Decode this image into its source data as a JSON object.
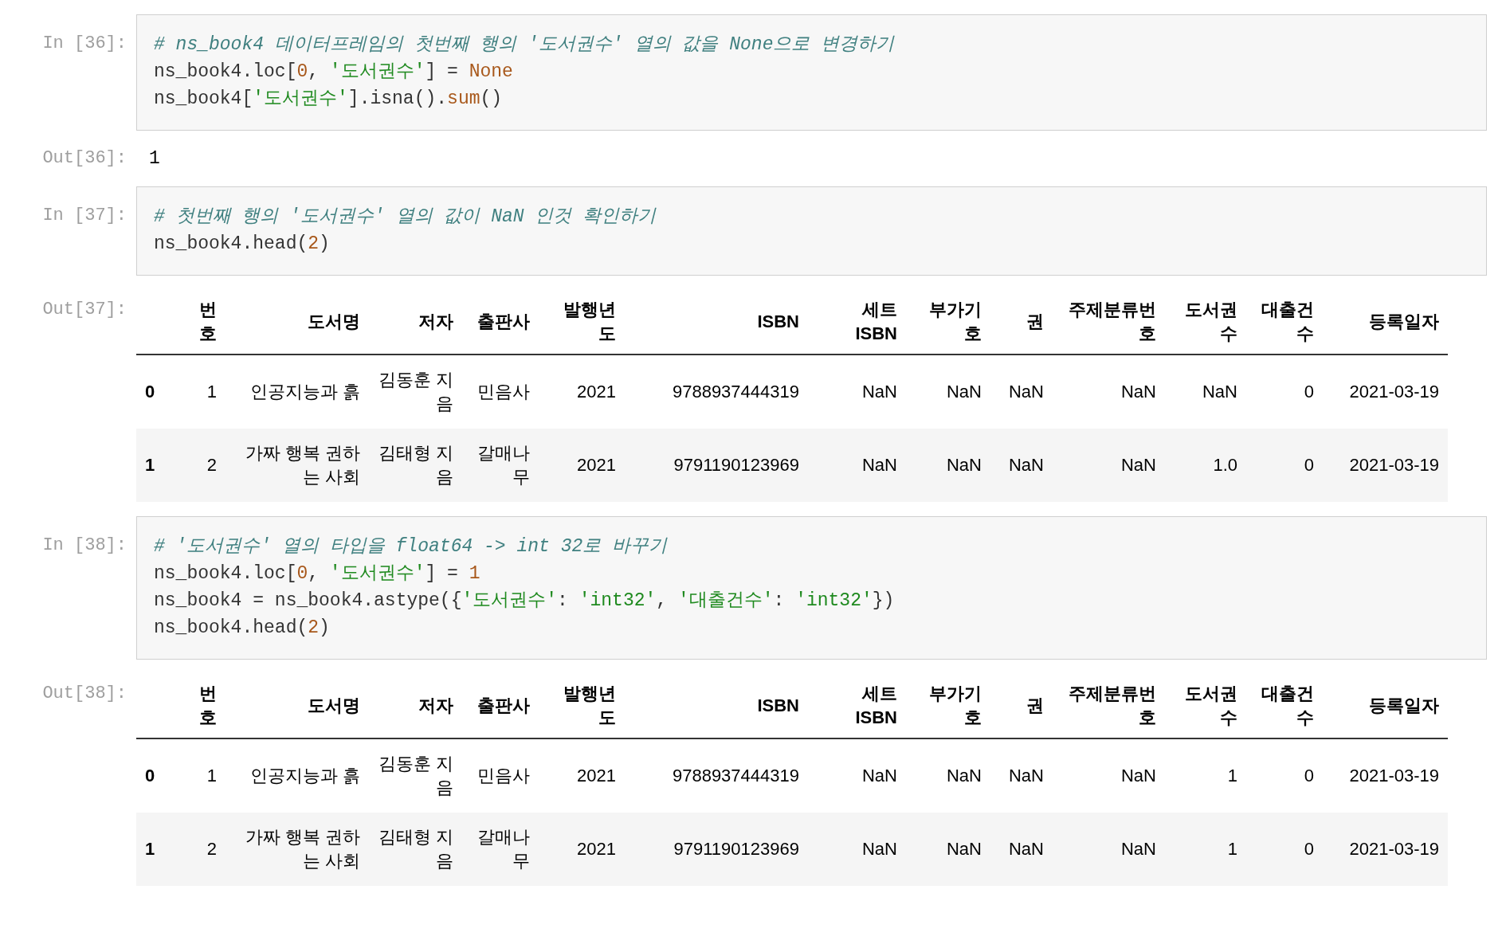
{
  "cells": [
    {
      "kind": "code",
      "prompt": "In [36]:",
      "lines": [
        [
          {
            "kind": "comment",
            "t": "# ns_book4 데이터프레임의 첫번째 행의 '도서권수' 열의 값을 None으로 변경하기"
          }
        ],
        [
          {
            "kind": "name",
            "t": "ns_book4.loc["
          },
          {
            "kind": "number",
            "t": "0"
          },
          {
            "kind": "name",
            "t": ", "
          },
          {
            "kind": "string",
            "t": "'도서권수'"
          },
          {
            "kind": "name",
            "t": "] = "
          },
          {
            "kind": "keyword",
            "t": "None"
          }
        ],
        [
          {
            "kind": "name",
            "t": "ns_book4["
          },
          {
            "kind": "string",
            "t": "'도서권수'"
          },
          {
            "kind": "name",
            "t": "].isna()."
          },
          {
            "kind": "builtin",
            "t": "sum"
          },
          {
            "kind": "name",
            "t": "()"
          }
        ]
      ]
    },
    {
      "kind": "text_output",
      "prompt": "Out[36]:",
      "text": "1"
    },
    {
      "kind": "code",
      "prompt": "In [37]:",
      "lines": [
        [
          {
            "kind": "comment",
            "t": "# 첫번째 행의 '도서권수' 열의 값이 NaN 인것 확인하기"
          }
        ],
        [
          {
            "kind": "name",
            "t": "ns_book4.head("
          },
          {
            "kind": "number",
            "t": "2"
          },
          {
            "kind": "name",
            "t": ")"
          }
        ]
      ]
    },
    {
      "kind": "table_output",
      "prompt": "Out[37]:",
      "columns": [
        "번호",
        "도서명",
        "저자",
        "출판사",
        "발행년도",
        "ISBN",
        "세트 ISBN",
        "부가기호",
        "권",
        "주제분류번호",
        "도서권수",
        "대출건수",
        "등록일자"
      ],
      "rows": [
        {
          "index": "0",
          "cells": [
            "1",
            "인공지능과 흙",
            "김동훈 지음",
            "민음사",
            "2021",
            "9788937444319",
            "NaN",
            "NaN",
            "NaN",
            "NaN",
            "NaN",
            "0",
            "2021-03-19"
          ]
        },
        {
          "index": "1",
          "cells": [
            "2",
            "가짜 행복 권하는 사회",
            "김태형 지음",
            "갈매나무",
            "2021",
            "9791190123969",
            "NaN",
            "NaN",
            "NaN",
            "NaN",
            "1.0",
            "0",
            "2021-03-19"
          ]
        }
      ]
    },
    {
      "kind": "code",
      "prompt": "In [38]:",
      "lines": [
        [
          {
            "kind": "comment",
            "t": "# '도서권수' 열의 타입을 float64 -> int 32로 바꾸기"
          }
        ],
        [
          {
            "kind": "name",
            "t": "ns_book4.loc["
          },
          {
            "kind": "number",
            "t": "0"
          },
          {
            "kind": "name",
            "t": ", "
          },
          {
            "kind": "string",
            "t": "'도서권수'"
          },
          {
            "kind": "name",
            "t": "] = "
          },
          {
            "kind": "number",
            "t": "1"
          }
        ],
        [
          {
            "kind": "name",
            "t": "ns_book4 = ns_book4.astype({"
          },
          {
            "kind": "string",
            "t": "'도서권수'"
          },
          {
            "kind": "name",
            "t": ": "
          },
          {
            "kind": "string",
            "t": "'int32'"
          },
          {
            "kind": "name",
            "t": ", "
          },
          {
            "kind": "string",
            "t": "'대출건수'"
          },
          {
            "kind": "name",
            "t": ": "
          },
          {
            "kind": "string",
            "t": "'int32'"
          },
          {
            "kind": "name",
            "t": "})"
          }
        ],
        [
          {
            "kind": "name",
            "t": "ns_book4.head("
          },
          {
            "kind": "number",
            "t": "2"
          },
          {
            "kind": "name",
            "t": ")"
          }
        ]
      ]
    },
    {
      "kind": "table_output",
      "prompt": "Out[38]:",
      "columns": [
        "번호",
        "도서명",
        "저자",
        "출판사",
        "발행년도",
        "ISBN",
        "세트 ISBN",
        "부가기호",
        "권",
        "주제분류번호",
        "도서권수",
        "대출건수",
        "등록일자"
      ],
      "rows": [
        {
          "index": "0",
          "cells": [
            "1",
            "인공지능과 흙",
            "김동훈 지음",
            "민음사",
            "2021",
            "9788937444319",
            "NaN",
            "NaN",
            "NaN",
            "NaN",
            "1",
            "0",
            "2021-03-19"
          ]
        },
        {
          "index": "1",
          "cells": [
            "2",
            "가짜 행복 권하는 사회",
            "김태형 지음",
            "갈매나무",
            "2021",
            "9791190123969",
            "NaN",
            "NaN",
            "NaN",
            "NaN",
            "1",
            "0",
            "2021-03-19"
          ]
        }
      ]
    }
  ]
}
